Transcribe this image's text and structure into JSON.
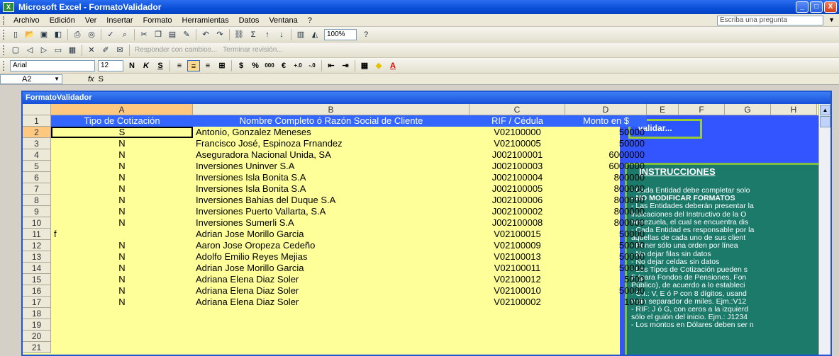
{
  "window": {
    "title": "Microsoft Excel - FormatoValidador",
    "app_icon": "excel-icon",
    "minimize": "_",
    "maximize": "□",
    "close": "X"
  },
  "menu": {
    "items": [
      "Archivo",
      "Edición",
      "Ver",
      "Insertar",
      "Formato",
      "Herramientas",
      "Datos",
      "Ventana",
      "?"
    ],
    "ask_placeholder": "Escriba una pregunta"
  },
  "toolbar_standard": {
    "zoom": "100%"
  },
  "toolbar_review": {
    "reply_text": "Responder con cambios...",
    "end_review_text": "Terminar revisión..."
  },
  "toolbar_format": {
    "font_name": "Arial",
    "font_size": "12",
    "bold": "N",
    "italic": "K",
    "underline": "S"
  },
  "formula_bar": {
    "name_box": "A2",
    "fx": "fx",
    "content": "S"
  },
  "workbook": {
    "title": "FormatoValidador",
    "columns": [
      "A",
      "B",
      "C",
      "D",
      "E",
      "F",
      "G",
      "H"
    ],
    "header_row": {
      "row": "1",
      "tipo": "Tipo de Cotización",
      "nombre": "Nombre Completo ó Razón Social de Cliente",
      "rif": "RIF / Cédula",
      "monto": "Monto en $"
    },
    "rows": [
      {
        "n": "2",
        "tipo": "S",
        "nombre": "Antonio,  Gonzalez Meneses",
        "rif": "V02100000",
        "monto": "50000"
      },
      {
        "n": "3",
        "tipo": "N",
        "nombre": "Francisco José, Espinoza Frnandez",
        "rif": "V02100005",
        "monto": "50000"
      },
      {
        "n": "4",
        "tipo": "N",
        "nombre": "Aseguradora Nacional Unida, SA",
        "rif": "J002100001",
        "monto": "6000000"
      },
      {
        "n": "5",
        "tipo": "N",
        "nombre": "Inversiones Uninver S.A",
        "rif": "J002100003",
        "monto": "6000000"
      },
      {
        "n": "6",
        "tipo": "N",
        "nombre": "Inversiones Isla Bonita S.A",
        "rif": "J002100004",
        "monto": "800000"
      },
      {
        "n": "7",
        "tipo": "N",
        "nombre": "Inversiones Isla Bonita S.A",
        "rif": "J002100005",
        "monto": "800000"
      },
      {
        "n": "8",
        "tipo": "N",
        "nombre": "Inversiones Bahias del Duque S.A",
        "rif": "J002100006",
        "monto": "800000"
      },
      {
        "n": "9",
        "tipo": "N",
        "nombre": "Inversiones Puerto Vallarta, S.A",
        "rif": "J002100002",
        "monto": "800000"
      },
      {
        "n": "10",
        "tipo": "N",
        "nombre": "Inversiones Sumerli S.A",
        "rif": "J002100008",
        "monto": "800000"
      },
      {
        "n": "11",
        "tipo": "f",
        "nombre": "Adrian Jose Morillo Garcia",
        "rif": "V02100015",
        "monto": "50000"
      },
      {
        "n": "12",
        "tipo": "N",
        "nombre": "Aaron Jose Oropeza Cedeño",
        "rif": "V02100009",
        "monto": "50000"
      },
      {
        "n": "13",
        "tipo": "N",
        "nombre": "Adolfo Emilio Reyes Mejias",
        "rif": "V02100013",
        "monto": "50000"
      },
      {
        "n": "14",
        "tipo": "N",
        "nombre": "Adrian Jose Morillo Garcia",
        "rif": "V02100011",
        "monto": "50000"
      },
      {
        "n": "15",
        "tipo": "N",
        "nombre": "Adriana Elena Diaz Soler",
        "rif": "V02100012",
        "monto": "5000"
      },
      {
        "n": "16",
        "tipo": "N",
        "nombre": "Adriana Elena Diaz Soler",
        "rif": "V02100010",
        "monto": "50000"
      },
      {
        "n": "17",
        "tipo": "N",
        "nombre": "Adriana Elena Diaz Soler",
        "rif": "V02100002",
        "monto": "1000"
      },
      {
        "n": "18",
        "tipo": "",
        "nombre": "",
        "rif": "",
        "monto": ""
      },
      {
        "n": "19",
        "tipo": "",
        "nombre": "",
        "rif": "",
        "monto": ""
      },
      {
        "n": "20",
        "tipo": "",
        "nombre": "",
        "rif": "",
        "monto": ""
      },
      {
        "n": "21",
        "tipo": "",
        "nombre": "",
        "rif": "",
        "monto": ""
      }
    ],
    "validar_button": "Validar...",
    "instructions": {
      "title": "INSTRUCCIONES",
      "lines": [
        "- Cada Entidad debe completar solo",
        "- NO MODIFICAR FORMATOS",
        "- Las Entidades deberán presentar la",
        "   indicaciones del Instructivo de la O",
        "   Venezuela, el cual se encuentra dis",
        "- Cada Entidad es responsable por la",
        "   aquellas de cada uno de sus client",
        "- Poner sólo una orden por línea",
        "- No dejar filas sin datos",
        "- No dejar celdas sin datos",
        "- Los Tipos de Cotización pueden s",
        "   F (para Fondos de Pensiones, Fon",
        "   Público), de acuerdo a lo estableci",
        "- C.I.: V, E ó P con 8 dígitos, usand",
        "   y sin separador de miles. Ejm.:V12",
        "- RIF: J ó G, con ceros a la izquierd",
        "   sólo el guión del inicio. Ejm.: J1234",
        "- Los montos en Dólares deben ser n"
      ]
    }
  },
  "colors": {
    "sheet_fill": "#ffff99",
    "header_fill": "#3366ff",
    "panel_fill": "#3355ff",
    "instructions_fill": "#1b7a6a",
    "selection": "#ffc880"
  }
}
